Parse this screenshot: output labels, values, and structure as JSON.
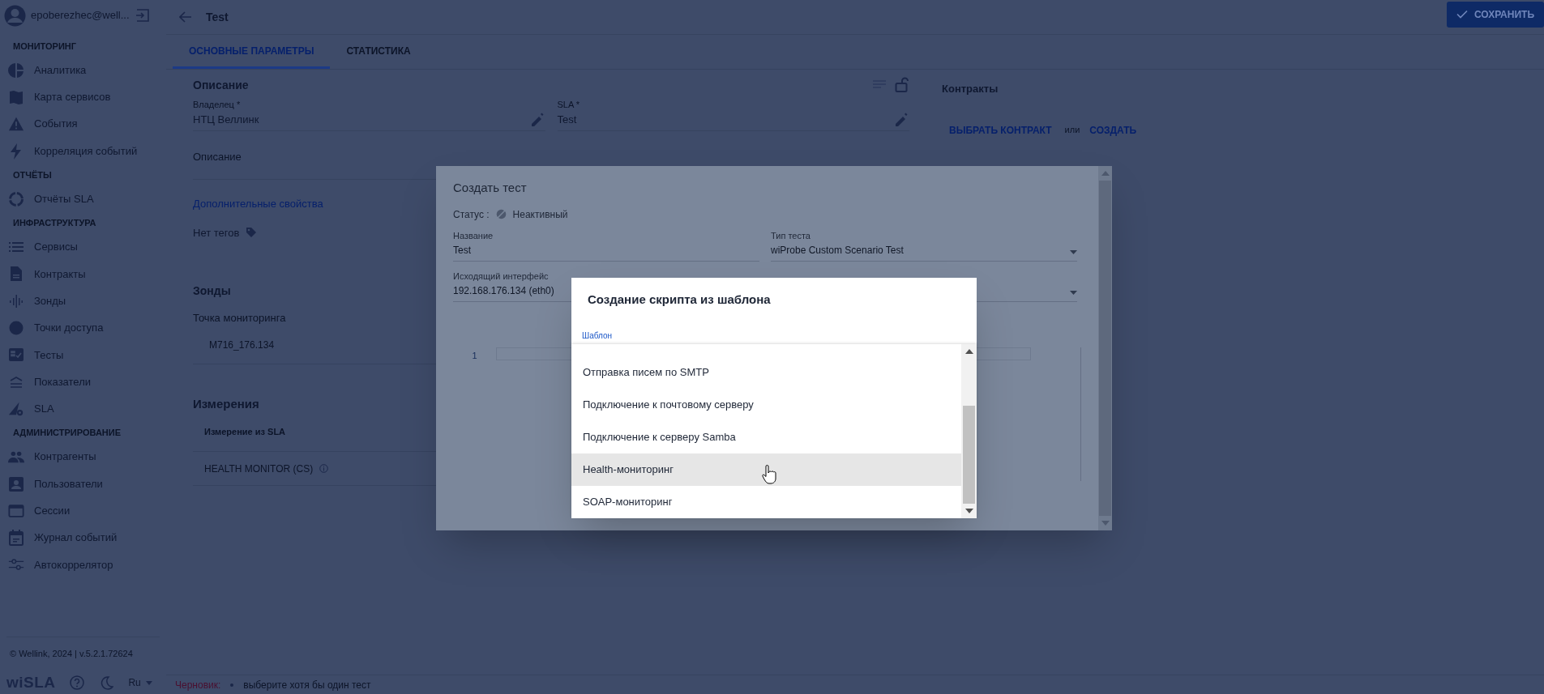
{
  "user": {
    "email": "epoberezhec@well..."
  },
  "sidebar": {
    "sections": [
      {
        "title": "МОНИТОРИНГ",
        "items": [
          {
            "label": "Аналитика",
            "kind": "pie"
          },
          {
            "label": "Карта сервисов",
            "kind": "map"
          },
          {
            "label": "События",
            "kind": "warning"
          },
          {
            "label": "Корреляция событий",
            "kind": "bolt"
          }
        ]
      },
      {
        "title": "ОТЧЁТЫ",
        "items": [
          {
            "label": "Отчёты SLA",
            "kind": "ring"
          }
        ]
      },
      {
        "title": "ИНФРАСТРУКТУРА",
        "items": [
          {
            "label": "Сервисы",
            "kind": "list"
          },
          {
            "label": "Контракты",
            "kind": "doc"
          },
          {
            "label": "Зонды",
            "kind": "probe"
          },
          {
            "label": "Точки доступа",
            "kind": "dot"
          },
          {
            "label": "Тесты",
            "kind": "tests"
          },
          {
            "label": "Показатели",
            "kind": "metrics"
          },
          {
            "label": "SLA",
            "kind": "sla"
          }
        ]
      },
      {
        "title": "АДМИНИСТРИРОВАНИЕ",
        "items": [
          {
            "label": "Контрагенты",
            "kind": "people"
          },
          {
            "label": "Пользователи",
            "kind": "user"
          },
          {
            "label": "Сессии",
            "kind": "window"
          },
          {
            "label": "Журнал событий",
            "kind": "calendar"
          },
          {
            "label": "Автокоррелятор",
            "kind": "sliders"
          }
        ]
      }
    ]
  },
  "sidebar_footer": {
    "copyright": "© Wellink, 2024 | v.5.2.1.72624",
    "logo": "wiSLA",
    "language": "Ru"
  },
  "header": {
    "title": "Test",
    "save_button": "СОХРАНИТЬ"
  },
  "tabs": [
    {
      "label": "ОСНОВНЫЕ ПАРАМЕТРЫ",
      "selected": true
    },
    {
      "label": "СТАТИСТИКА",
      "selected": false
    }
  ],
  "description": {
    "title": "Описание",
    "fields": [
      {
        "label": "Владелец *",
        "value": "НТЦ Веллинк"
      },
      {
        "label": "SLA *",
        "value": "Test"
      }
    ],
    "description_placeholder": "Описание",
    "more_link": "Дополнительные свойства",
    "tags": "Нет тегов"
  },
  "probes": {
    "title": "Зонды",
    "label": "Точка мониторинга",
    "value": "M716_176.134"
  },
  "measurements": {
    "title": "Измерения",
    "column": "Измерение из SLA",
    "rows": [
      "HEALTH MONITOR (CS)"
    ]
  },
  "contracts": {
    "title": "Контракты",
    "choose": "ВЫБРАТЬ КОНТРАКТ",
    "or": "или",
    "create": "СОЗДАТЬ"
  },
  "status_bar": {
    "label": "Черновик:",
    "messages": [
      "выберите хотя бы один тест"
    ]
  },
  "create_test_dialog": {
    "title": "Создать тест",
    "status_label": "Статус :",
    "status": "Неактивный",
    "fields": [
      {
        "kind": "text",
        "label": "Название",
        "value": "Test"
      },
      {
        "kind": "select",
        "label": "Тип теста",
        "value": "wiProbe Custom Scenario Test"
      },
      {
        "kind": "text",
        "label": "Исходящий интерфейс",
        "value": "192.168.176.134 (eth0)"
      },
      {
        "kind": "select"
      }
    ],
    "editor": {
      "line_numbers": [
        "1"
      ]
    }
  },
  "template_dialog": {
    "title": "Создание скрипта из шаблона",
    "field_label": "Шаблон",
    "options": [
      {
        "label": "Отправка писем по SMTP",
        "selected": false
      },
      {
        "label": "Подключение к почтовому серверу",
        "selected": false
      },
      {
        "label": "Подключение к серверу Samba",
        "selected": false
      },
      {
        "label": "Health-мониторинг",
        "selected": true
      },
      {
        "label": "SOAP-мониторинг",
        "selected": false
      }
    ]
  }
}
